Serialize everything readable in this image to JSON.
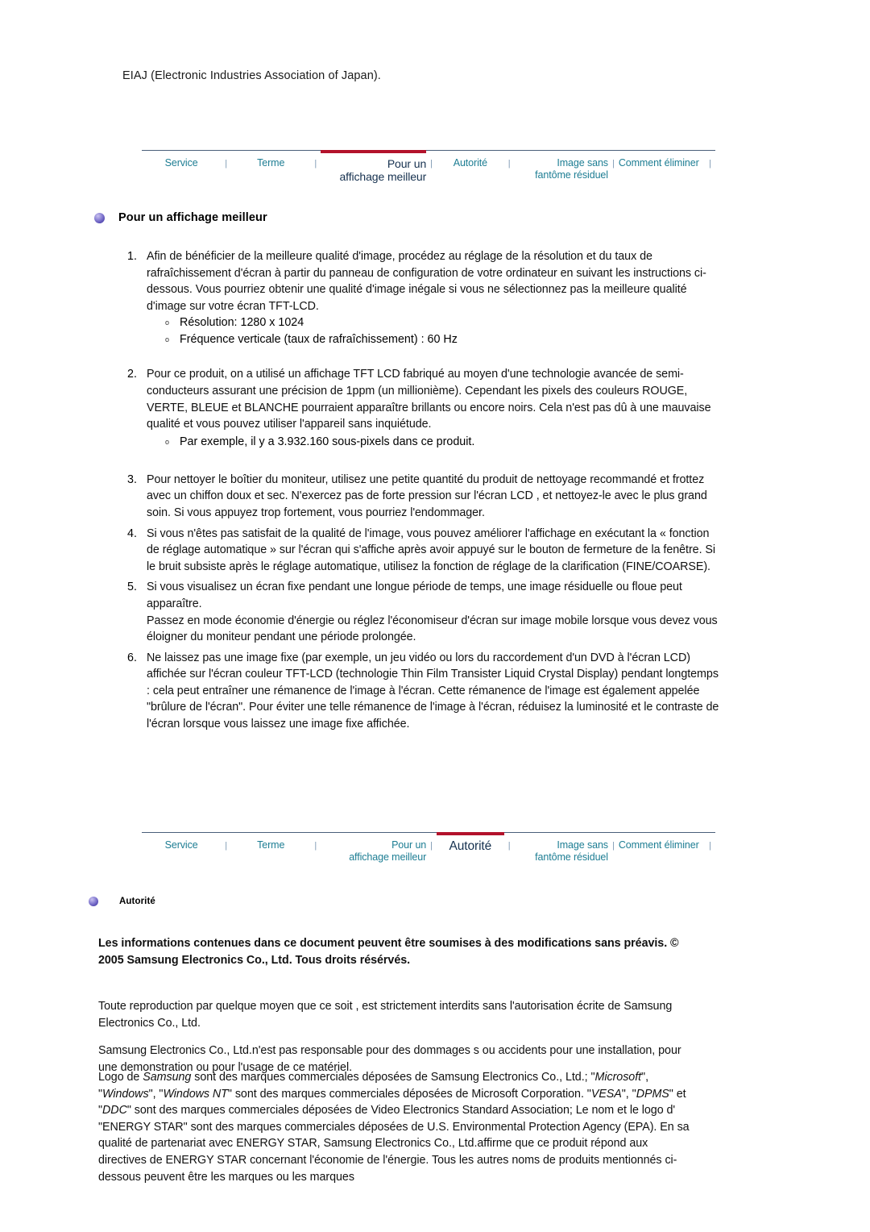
{
  "intro": {
    "text": "EIAJ (Electronic Industries Association of Japan)."
  },
  "colors": {
    "nav_link": "#1d7d93",
    "nav_active": "#16314f",
    "nav_accent": "#b3122b",
    "nav_rule": "#4a5f7a",
    "bullet": "#5d52b8",
    "text": "#111111"
  },
  "nav_top": {
    "separator": "|",
    "items": [
      {
        "label": "Service",
        "active": false
      },
      {
        "label": "Terme",
        "active": false
      },
      {
        "label": "Pour un\naffichage meilleur",
        "active": true
      },
      {
        "label": "Autorité",
        "active": false
      },
      {
        "label": "Image sans\nfantôme résiduel",
        "active": false
      },
      {
        "label": "Comment éliminer",
        "active": false
      }
    ]
  },
  "nav_bottom": {
    "separator": "|",
    "items": [
      {
        "label": "Service",
        "active": false
      },
      {
        "label": "Terme",
        "active": false
      },
      {
        "label": "Pour un\naffichage meilleur",
        "active": false
      },
      {
        "label": "Autorité",
        "active": true
      },
      {
        "label": "Image sans\nfantôme résiduel",
        "active": false
      },
      {
        "label": "Comment éliminer",
        "active": false
      }
    ]
  },
  "section_affichage": {
    "heading": "Pour un affichage meilleur",
    "items": [
      {
        "number": "1.",
        "text": "Afin de bénéficier de la meilleure qualité d'image, procédez au réglage de la résolution et du taux de rafraîchissement d'écran à partir du panneau de configuration de votre ordinateur en suivant les instructions ci-dessous. Vous pourriez obtenir une qualité d'image inégale si vous ne sélectionnez pas la meilleure qualité d'image sur votre écran TFT-LCD."
      },
      {
        "number": "2.",
        "text": "Pour ce produit, on a utilisé un affichage TFT LCD fabriqué au moyen d'une technologie avancée de semi-conducteurs assurant une précision de 1ppm (un millionième). Cependant les pixels des couleurs ROUGE, VERTE, BLEUE et BLANCHE pourraient apparaître brillants ou encore noirs. Cela n'est pas dû à une mauvaise qualité et vous pouvez utiliser l'appareil sans inquiétude."
      },
      {
        "number": "3.",
        "text": "Pour nettoyer le boîtier du moniteur, utilisez une petite quantité du produit de nettoyage recommandé et frottez avec un chiffon doux et sec. N'exercez pas de forte pression sur l'écran LCD , et nettoyez-le avec le plus grand soin. Si vous appuyez trop fortement, vous pourriez l'endommager."
      },
      {
        "number": "4.",
        "text": "Si vous n'êtes pas satisfait de la qualité de l'image, vous pouvez améliorer l'affichage en exécutant la « fonction de réglage automatique » sur l'écran qui s'affiche après avoir appuyé sur le bouton de fermeture de la fenêtre. Si le bruit subsiste après le réglage automatique, utilisez la fonction de réglage de la clarification (FINE/COARSE)."
      },
      {
        "number": "5.",
        "text": "Si vous visualisez un écran fixe pendant une longue période de temps, une image résiduelle ou floue peut apparaître.\nPassez en mode économie d'énergie ou réglez l'économiseur d'écran sur image mobile lorsque vous devez vous éloigner du moniteur pendant une période prolongée."
      },
      {
        "number": "6.",
        "text": "Ne laissez pas une image fixe (par exemple, un jeu vidéo ou lors du raccordement d'un DVD à l'écran LCD) affichée sur l'écran couleur TFT-LCD (technologie Thin Film Transister Liquid Crystal Display) pendant longtemps : cela peut entraîner une rémanence de l'image à l'écran. Cette rémanence de l'image est également appelée \"brûlure de l'écran\". Pour éviter une telle rémanence de l'image à l'écran, réduisez la luminosité et le contraste de l'écran lorsque vous laissez une image fixe affichée."
      }
    ],
    "sublist_1": {
      "marker": "o",
      "items": [
        "Résolution: 1280 x 1024",
        "Fréquence verticale (taux de rafraîchissement) : 60 Hz"
      ]
    },
    "sublist_2": {
      "marker": "o",
      "items": [
        "Par exemple, il y a 3.932.160 sous-pixels dans ce produit."
      ]
    }
  },
  "section_autorite": {
    "heading": "Autorité",
    "notice_bold": "Les informations contenues dans ce document peuvent être soumises à des modifications sans préavis. © 2005 Samsung Electronics Co., Ltd. Tous droits résérvés.",
    "paragraph_1": "Toute reproduction par quelque moyen que ce soit , est strictement interdits sans l'autorisation écrite de Samsung Electronics Co., Ltd.",
    "paragraph_2": "Samsung Electronics Co., Ltd.n'est pas responsable pour des dommages s ou accidents pour une installation, pour une demonstration ou pour l'usage de ce matériel.",
    "paragraph_3_segments": [
      {
        "t": "Logo de ",
        "i": false
      },
      {
        "t": "Samsung",
        "i": true
      },
      {
        "t": " sont des marques commerciales déposées de Samsung Electronics Co., Ltd.; \"",
        "i": false
      },
      {
        "t": "Microsoft",
        "i": true
      },
      {
        "t": "\", \"",
        "i": false
      },
      {
        "t": "Windows",
        "i": true
      },
      {
        "t": "\", \"",
        "i": false
      },
      {
        "t": "Windows NT",
        "i": true
      },
      {
        "t": "\" sont des marques commerciales déposées de Microsoft Corporation. \"",
        "i": false
      },
      {
        "t": "VESA",
        "i": true
      },
      {
        "t": "\", \"",
        "i": false
      },
      {
        "t": "DPMS",
        "i": true
      },
      {
        "t": "\" et \"",
        "i": false
      },
      {
        "t": "DDC",
        "i": true
      },
      {
        "t": "\" sont des marques commerciales déposées de Video Electronics Standard Association; Le nom et le logo d' \"ENERGY STAR\" sont des marques commerciales déposées de U.S. Environmental Protection Agency (EPA). En sa qualité de partenariat avec ENERGY STAR, Samsung Electronics Co., Ltd.affirme que ce produit répond aux directives de ENERGY STAR concernant l'économie de l'énergie. Tous les autres noms de produits mentionnés ci-dessous peuvent être les marques ou les marques",
        "i": false
      }
    ]
  }
}
